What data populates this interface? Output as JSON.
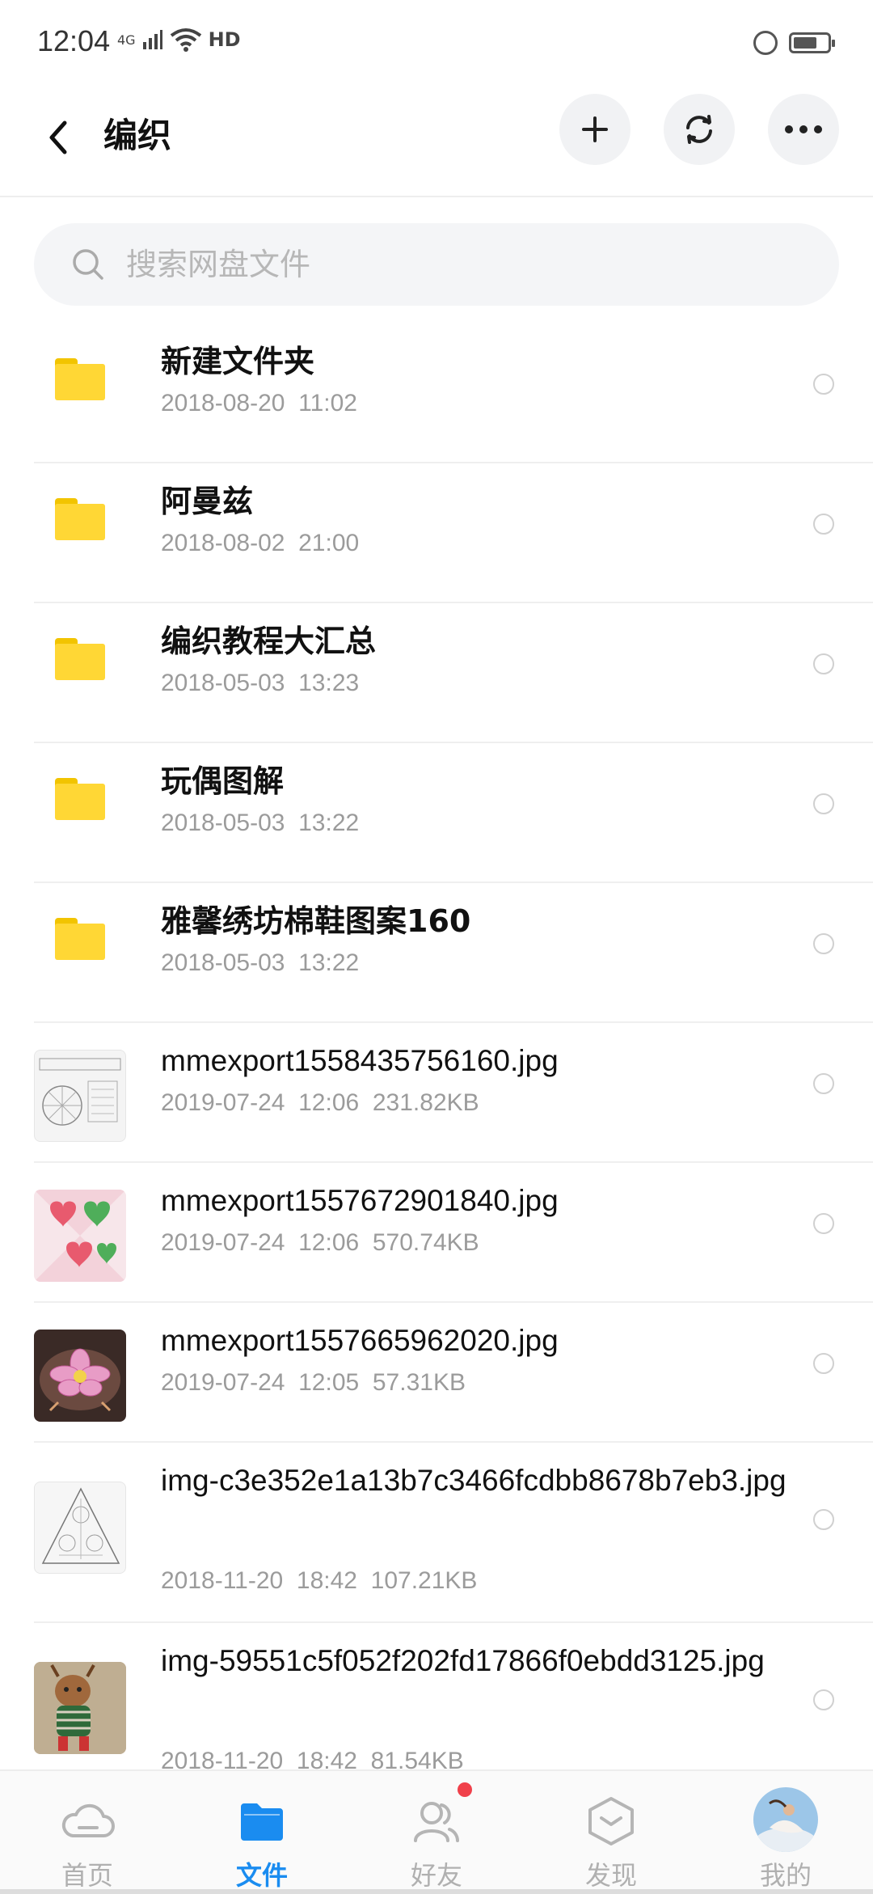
{
  "status": {
    "time": "12:04",
    "network": "4G",
    "hd": "HD"
  },
  "header": {
    "title": "编织",
    "back_icon": "back-arrow-icon",
    "add_icon": "plus-icon",
    "sync_icon": "sync-icon",
    "more_icon": "more-icon"
  },
  "search": {
    "placeholder": "搜索网盘文件"
  },
  "files": [
    {
      "name": "新建文件夹",
      "meta": "2018-08-20  11:02",
      "kind": "folder"
    },
    {
      "name": "阿曼兹",
      "meta": "2018-08-02  21:00",
      "kind": "folder"
    },
    {
      "name": "编织教程大汇总",
      "meta": "2018-05-03  13:23",
      "kind": "folder"
    },
    {
      "name": "玩偶图解",
      "meta": "2018-05-03  13:22",
      "kind": "folder"
    },
    {
      "name": "雅馨绣坊棉鞋图案160",
      "meta": "2018-05-03  13:22",
      "kind": "folder"
    },
    {
      "name": "mmexport1558435756160.jpg",
      "meta": "2019-07-24  12:06  231.82KB",
      "kind": "image"
    },
    {
      "name": "mmexport1557672901840.jpg",
      "meta": "2019-07-24  12:06  570.74KB",
      "kind": "image"
    },
    {
      "name": "mmexport1557665962020.jpg",
      "meta": "2019-07-24  12:05  57.31KB",
      "kind": "image"
    },
    {
      "name": "img-c3e352e1a13b7c3466fcdbb8678b7eb3.jpg",
      "meta": "2018-11-20  18:42  107.21KB",
      "kind": "image"
    },
    {
      "name": "img-59551c5f052f202fd17866f0ebdd3125.jpg",
      "meta": "2018-11-20  18:42  81.54KB",
      "kind": "image"
    }
  ],
  "nav": [
    {
      "label": "首页",
      "icon": "home-cloud-icon"
    },
    {
      "label": "文件",
      "icon": "folder-icon",
      "active": true
    },
    {
      "label": "好友",
      "icon": "friends-icon",
      "badge": true
    },
    {
      "label": "发现",
      "icon": "discover-icon"
    },
    {
      "label": "我的",
      "icon": "avatar"
    }
  ],
  "colors": {
    "accent": "#1a8cf0",
    "folder": "#ffd735",
    "badge": "#f0404a"
  }
}
